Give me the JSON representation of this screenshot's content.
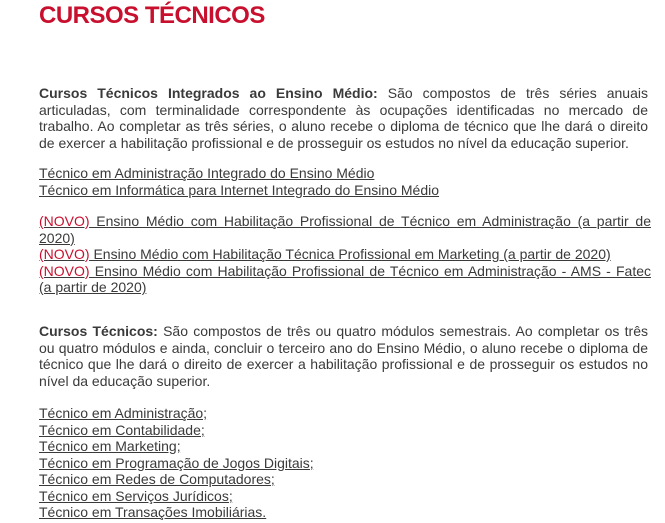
{
  "title": "CURSOS TÉCNICOS",
  "integrados": {
    "label": "Cursos Técnicos Integrados ao Ensino Médio:",
    "text": " São compostos de três séries anuais articuladas, com terminalidade correspondente às ocupações identificadas no mercado de trabalho. Ao completar as três séries, o aluno recebe o diploma de técnico que lhe dará o direito de exercer a habilitação profissional e de prosseguir os estudos no nível da educação superior.",
    "links": [
      "Técnico em Administração Integrado do Ensino Médio",
      "Técnico em Informática para Internet Integrado do Ensino Médio"
    ]
  },
  "novos": {
    "tag": "(NOVO)",
    "items": [
      " Ensino Médio com Habilitação Profissional de Técnico em Administração (a partir de 2020)",
      " Ensino Médio com Habilitação Técnica Profissional em Marketing (a partir de 2020)",
      " Ensino Médio com Habilitação Profissional de Técnico em Administração - AMS - Fatec (a partir de 2020)"
    ]
  },
  "modulares": {
    "label": "Cursos Técnicos:",
    "text": " São compostos de três ou quatro módulos semestrais. Ao completar os três ou quatro módulos e ainda, concluir o terceiro ano do Ensino Médio, o aluno recebe o diploma de técnico que lhe dará o direito de exercer a habilitação profissional e de prosseguir os estudos no nível da educação superior.",
    "links": [
      "Técnico em Administração;",
      "Técnico em Contabilidade;",
      "Técnico em Marketing;",
      "Técnico em Programação de Jogos Digitais;",
      "Técnico em Redes de Computadores;",
      "Técnico em Serviços Jurídicos;",
      "Técnico em Transações Imobiliárias. "
    ]
  },
  "colors": {
    "accent": "#c8102e",
    "text": "#3a3a3a",
    "background": "#ffffff"
  }
}
